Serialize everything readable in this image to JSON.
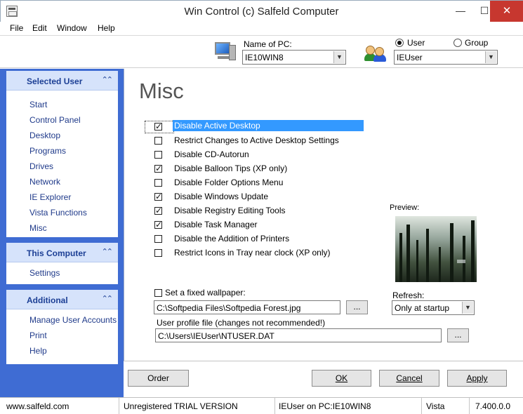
{
  "window": {
    "title": "Win Control (c) Salfeld Computer",
    "min_glyph": "—",
    "max_glyph": "☐",
    "close_glyph": "✕"
  },
  "menu": [
    "File",
    "Edit",
    "Window",
    "Help"
  ],
  "topbar": {
    "pc_label": "Name of PC:",
    "pc_value": "IE10WIN8",
    "user_option": "User",
    "group_option": "Group",
    "user_selected": true,
    "user_value": "IEUser",
    "dropdown_arrow": "▼"
  },
  "sidebar": {
    "chevron": "⌃⌃",
    "selected_user": {
      "title": "Selected User",
      "items": [
        "Start",
        "Control Panel",
        "Desktop",
        "Programs",
        "Drives",
        "Network",
        "IE Explorer",
        "Vista Functions",
        "Misc"
      ]
    },
    "this_computer": {
      "title": "This Computer",
      "items": [
        "Settings"
      ]
    },
    "additional": {
      "title": "Additional",
      "items": [
        "Manage User Accounts",
        "Print",
        "Help"
      ]
    }
  },
  "main": {
    "heading": "Misc",
    "options": [
      {
        "label": "Disable Active Desktop",
        "checked": true,
        "selected": true
      },
      {
        "label": "Restrict Changes to Active Desktop Settings",
        "checked": false
      },
      {
        "label": "Disable CD-Autorun",
        "checked": false
      },
      {
        "label": "Disable Balloon Tips (XP only)",
        "checked": true
      },
      {
        "label": "Disable Folder Options Menu",
        "checked": false
      },
      {
        "label": "Disable Windows Update",
        "checked": true
      },
      {
        "label": "Disable Registry Editing Tools",
        "checked": true
      },
      {
        "label": "Disable Task Manager",
        "checked": true
      },
      {
        "label": "Disable the Addition of Printers",
        "checked": false
      },
      {
        "label": "Restrict Icons in Tray near clock (XP only)",
        "checked": false
      }
    ],
    "preview_label": "Preview:",
    "wallpaper": {
      "label": "Set a fixed wallpaper:",
      "checked": false,
      "path": "C:\\Softpedia Files\\Softpedia Forest.jpg"
    },
    "refresh": {
      "label": "Refresh:",
      "value": "Only at startup"
    },
    "profile": {
      "label": "User profile file (changes not recommended!)",
      "path": "C:\\Users\\IEUser\\NTUSER.DAT"
    },
    "browse_label": "...",
    "buttons": {
      "order": "Order",
      "ok": "OK",
      "cancel": "Cancel",
      "apply": "Apply"
    }
  },
  "status": {
    "website": "www.salfeld.com",
    "license": "Unregistered TRIAL VERSION",
    "context": "IEUser on PC:IE10WIN8",
    "os": "Vista",
    "version": "7.400.0.0"
  }
}
